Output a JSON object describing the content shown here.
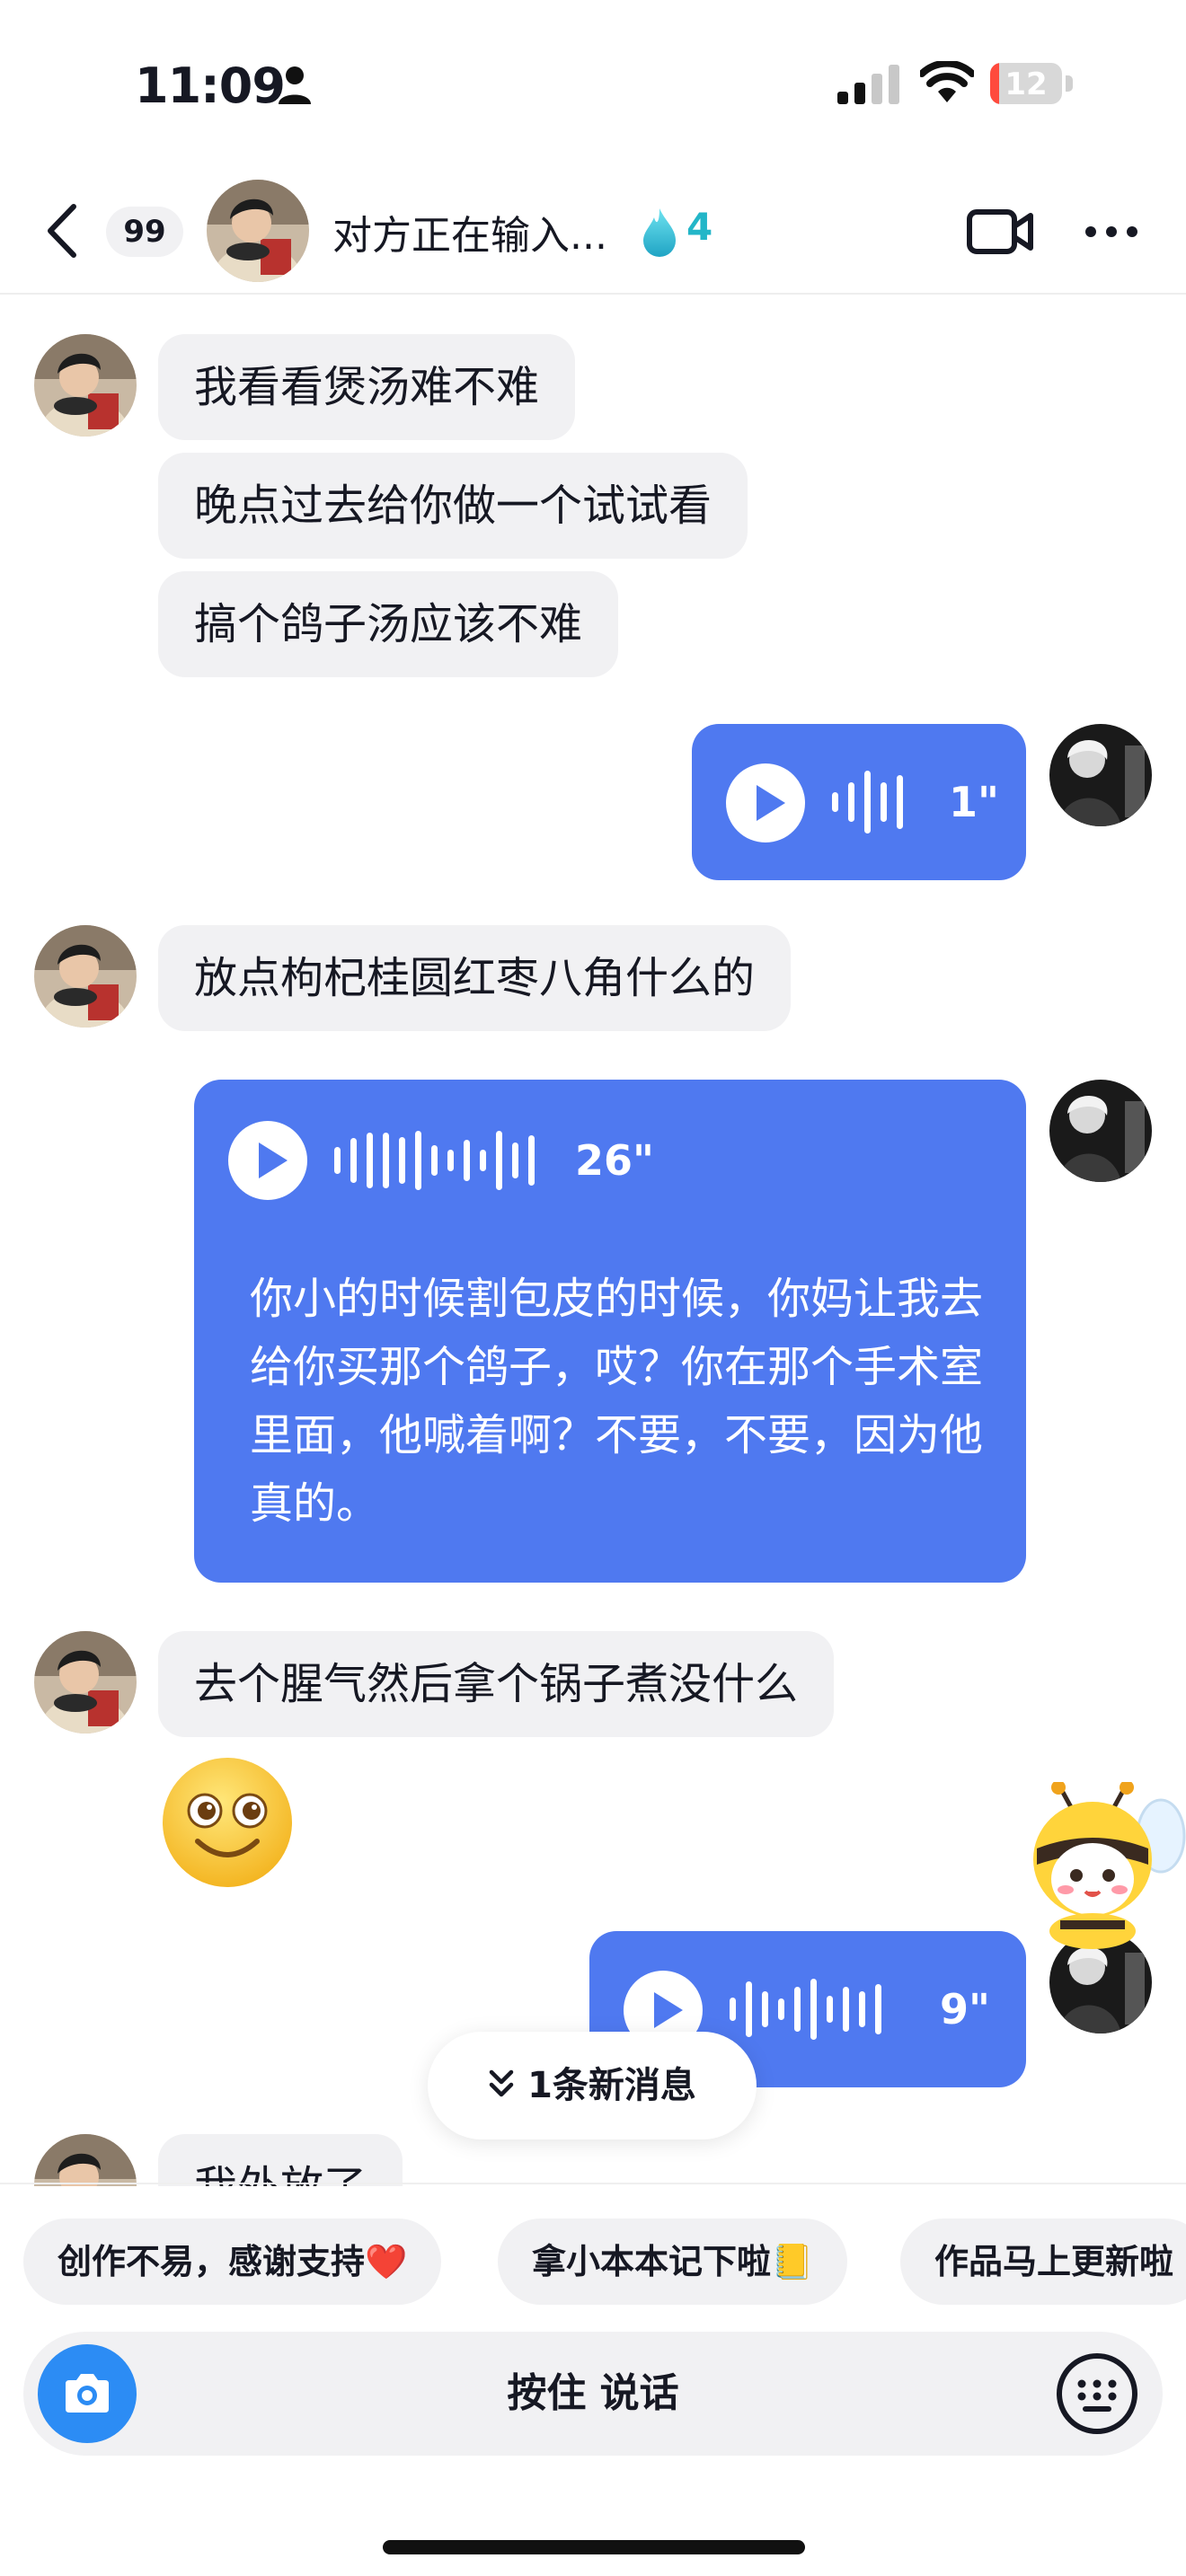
{
  "status_bar": {
    "time": "11:09",
    "battery": "12",
    "battery_level": 0.12
  },
  "header": {
    "unread_count": "99",
    "status_text": "对方正在输入...",
    "streak_count": "4",
    "icons": [
      "chevron-left-icon",
      "video-call-icon",
      "more-icon",
      "flame-drop-icon"
    ]
  },
  "messages": {
    "m1": "我看看煲汤难不难",
    "m2": "晚点过去给你做一个试试看",
    "m3": "搞个鸽子汤应该不难",
    "voice1_duration": "1\"",
    "m4": "放点枸杞桂圆红枣八角什么的",
    "voice2_duration": "26\"",
    "voice2_transcript": "你小的时候割包皮的时候，你妈让我去给你买那个鸽子，哎？你在那个手术室里面，他喊着啊？不要，不要，因为他真的。",
    "m5": "去个腥气然后拿个锅子煮没什么",
    "voice3_duration": "9\"",
    "m6_partial": "我外放了"
  },
  "new_message_pill": "1条新消息",
  "quick_replies": [
    "创作不易，感谢支持❤️",
    "拿小本本记下啦📒",
    "作品马上更新啦"
  ],
  "composer": {
    "hold_to_talk": "按住 说话"
  },
  "colors": {
    "accent_blue": "#4f79f0",
    "incoming_bubble": "#f1f1f3",
    "streak": "#23b6c8",
    "camera": "#2c8cf4"
  }
}
